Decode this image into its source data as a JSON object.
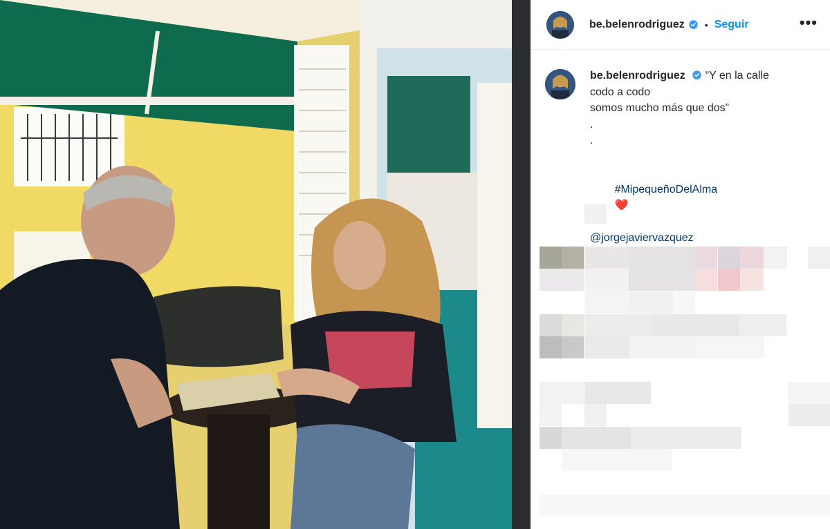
{
  "header": {
    "username": "be.belenrodriguez",
    "separator": "•",
    "follow_label": "Seguir",
    "more_label": "•••"
  },
  "caption": {
    "username": "be.belenrodriguez",
    "lines": [
      "“Y en la calle",
      "codo a codo",
      "somos mucho más que dos”",
      ".",
      "."
    ],
    "hashtag": "#MipequeñoDelAlma",
    "heart": "❤️",
    "mention": "@jorgejaviervazquez"
  },
  "colors": {
    "accent": "#0095f6",
    "link": "#00376b",
    "verified": "#3897f0",
    "text": "#262626"
  },
  "icons": {
    "verified": "verified-badge-icon",
    "more": "more-options-icon"
  }
}
